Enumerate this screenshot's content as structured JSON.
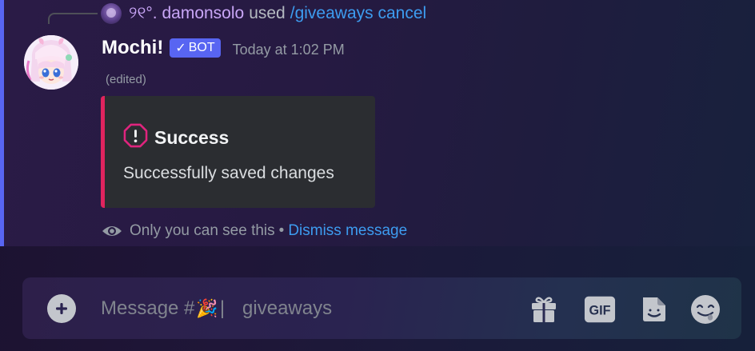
{
  "colors": {
    "accent": "#5865f2",
    "embed_bar": "#e0245e",
    "link": "#3d9cf0",
    "username": "#ffffff",
    "reply_user": "#c9a6f7"
  },
  "reply": {
    "user": "୨୧°. damonsolo",
    "used": "used",
    "command": "/giveaways cancel",
    "avatar_icon": "user-avatar"
  },
  "message": {
    "author": "Mochi!",
    "bot_tag": "BOT",
    "bot_check": "✓",
    "timestamp": "Today at 1:02 PM",
    "edited": "(edited)",
    "avatar_icon": "anime-girl-avatar"
  },
  "embed": {
    "title_icon": "alert-octagon-icon",
    "title": "Success",
    "description": "Successfully saved changes"
  },
  "ephemeral": {
    "icon": "eye-icon",
    "text": "Only you can see this",
    "separator": "•",
    "dismiss": "Dismiss message"
  },
  "composer": {
    "placeholder_prefix": "Message #",
    "channel_emoji": "🎉",
    "channel_separator": "|",
    "channel_name": "giveaways",
    "icons": [
      "plus-icon",
      "gift-icon",
      "gif-icon",
      "sticker-icon",
      "emoji-icon"
    ],
    "gif_label": "GIF"
  }
}
